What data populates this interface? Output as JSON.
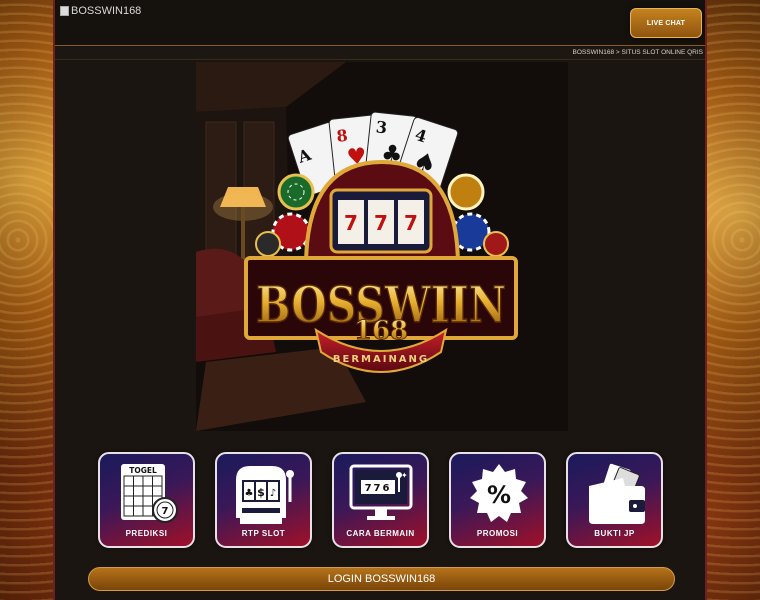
{
  "header": {
    "logo_alt": "BOSSWIN168",
    "live_chat_label": "LIVE CHAT"
  },
  "breadcrumb": "BOSSWIN168 > SITUS SLOT ONLINE QRIS",
  "hero": {
    "brand": "BOSSWIIN",
    "number": "168",
    "tagline": "BERMAINANG",
    "slot_digits": [
      "7",
      "7",
      "7"
    ]
  },
  "menu": [
    {
      "label": "PREDIKSI",
      "caption": "TOGEL",
      "icon": "lottery-ticket-icon"
    },
    {
      "label": "RTP SLOT",
      "caption": "",
      "icon": "slot-machine-icon"
    },
    {
      "label": "CARA BERMAIN",
      "caption": "",
      "icon": "monitor-slot-icon"
    },
    {
      "label": "PROMOSI",
      "caption": "",
      "icon": "percent-badge-icon"
    },
    {
      "label": "BUKTI JP",
      "caption": "",
      "icon": "wallet-icon"
    }
  ],
  "icon_text": {
    "prediksi_ball": "7",
    "rtp_symbols": [
      "♣",
      "$",
      "♪"
    ],
    "cara_digits": "776",
    "promosi_symbol": "%"
  },
  "login_label": "LOGIN BOSSWIN168",
  "colors": {
    "accent_gold": "#c5821f",
    "panel_border": "#6e1f1f",
    "menu_gradient_start": "#1a1a5c",
    "menu_gradient_end": "#a01028"
  }
}
